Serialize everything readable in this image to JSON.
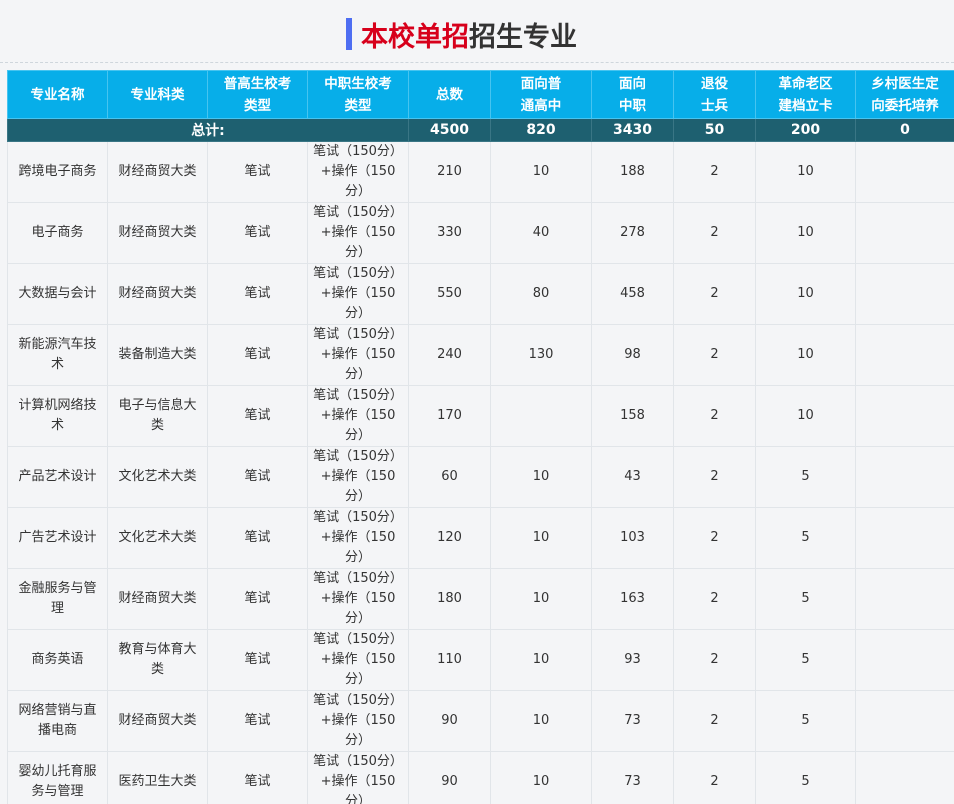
{
  "page": {
    "title_red": "本校单招",
    "title_dark": "招生专业"
  },
  "table": {
    "headers": [
      [
        "专业名称"
      ],
      [
        "专业科类"
      ],
      [
        "普高生校考",
        "类型"
      ],
      [
        "中职生校考",
        "类型"
      ],
      [
        "总数"
      ],
      [
        "面向普",
        "通高中"
      ],
      [
        "面向",
        "中职"
      ],
      [
        "退役",
        "士兵"
      ],
      [
        "革命老区",
        "建档立卡"
      ],
      [
        "乡村医生定",
        "向委托培养"
      ]
    ],
    "total": {
      "label": "总计:",
      "total": "4500",
      "high_school": "820",
      "vocational": "3430",
      "veterans": "50",
      "old_area": "200",
      "rural_doctor": "0"
    },
    "rows": [
      {
        "name": [
          "跨境电子商务"
        ],
        "category": [
          "财经商贸大类"
        ],
        "hs_exam": "笔试",
        "vc_exam": [
          "笔试（150分）",
          "+操作（150",
          "分）"
        ],
        "total": "210",
        "high_school": "10",
        "vocational": "188",
        "veterans": "2",
        "old_area": "10",
        "rural_doctor": ""
      },
      {
        "name": [
          "电子商务"
        ],
        "category": [
          "财经商贸大类"
        ],
        "hs_exam": "笔试",
        "vc_exam": [
          "笔试（150分）",
          "+操作（150",
          "分）"
        ],
        "total": "330",
        "high_school": "40",
        "vocational": "278",
        "veterans": "2",
        "old_area": "10",
        "rural_doctor": ""
      },
      {
        "name": [
          "大数据与会计"
        ],
        "category": [
          "财经商贸大类"
        ],
        "hs_exam": "笔试",
        "vc_exam": [
          "笔试（150分）",
          "+操作（150",
          "分）"
        ],
        "total": "550",
        "high_school": "80",
        "vocational": "458",
        "veterans": "2",
        "old_area": "10",
        "rural_doctor": ""
      },
      {
        "name": [
          "新能源汽车技",
          "术"
        ],
        "category": [
          "装备制造大类"
        ],
        "hs_exam": "笔试",
        "vc_exam": [
          "笔试（150分）",
          "+操作（150",
          "分）"
        ],
        "total": "240",
        "high_school": "130",
        "vocational": "98",
        "veterans": "2",
        "old_area": "10",
        "rural_doctor": ""
      },
      {
        "name": [
          "计算机网络技",
          "术"
        ],
        "category": [
          "电子与信息大",
          "类"
        ],
        "hs_exam": "笔试",
        "vc_exam": [
          "笔试（150分）",
          "+操作（150",
          "分）"
        ],
        "total": "170",
        "high_school": "",
        "vocational": "158",
        "veterans": "2",
        "old_area": "10",
        "rural_doctor": ""
      },
      {
        "name": [
          "产品艺术设计"
        ],
        "category": [
          "文化艺术大类"
        ],
        "hs_exam": "笔试",
        "vc_exam": [
          "笔试（150分）",
          "+操作（150",
          "分）"
        ],
        "total": "60",
        "high_school": "10",
        "vocational": "43",
        "veterans": "2",
        "old_area": "5",
        "rural_doctor": ""
      },
      {
        "name": [
          "广告艺术设计"
        ],
        "category": [
          "文化艺术大类"
        ],
        "hs_exam": "笔试",
        "vc_exam": [
          "笔试（150分）",
          "+操作（150",
          "分）"
        ],
        "total": "120",
        "high_school": "10",
        "vocational": "103",
        "veterans": "2",
        "old_area": "5",
        "rural_doctor": ""
      },
      {
        "name": [
          "金融服务与管",
          "理"
        ],
        "category": [
          "财经商贸大类"
        ],
        "hs_exam": "笔试",
        "vc_exam": [
          "笔试（150分）",
          "+操作（150",
          "分）"
        ],
        "total": "180",
        "high_school": "10",
        "vocational": "163",
        "veterans": "2",
        "old_area": "5",
        "rural_doctor": ""
      },
      {
        "name": [
          "商务英语"
        ],
        "category": [
          "教育与体育大",
          "类"
        ],
        "hs_exam": "笔试",
        "vc_exam": [
          "笔试（150分）",
          "+操作（150",
          "分）"
        ],
        "total": "110",
        "high_school": "10",
        "vocational": "93",
        "veterans": "2",
        "old_area": "5",
        "rural_doctor": ""
      },
      {
        "name": [
          "网络营销与直",
          "播电商"
        ],
        "category": [
          "财经商贸大类"
        ],
        "hs_exam": "笔试",
        "vc_exam": [
          "笔试（150分）",
          "+操作（150",
          "分）"
        ],
        "total": "90",
        "high_school": "10",
        "vocational": "73",
        "veterans": "2",
        "old_area": "5",
        "rural_doctor": ""
      },
      {
        "name": [
          "婴幼儿托育服",
          "务与管理"
        ],
        "category": [
          "医药卫生大类"
        ],
        "hs_exam": "笔试",
        "vc_exam": [
          "笔试（150分）",
          "+操作（150",
          "分）"
        ],
        "total": "90",
        "high_school": "10",
        "vocational": "73",
        "veterans": "2",
        "old_area": "5",
        "rural_doctor": ""
      }
    ]
  }
}
